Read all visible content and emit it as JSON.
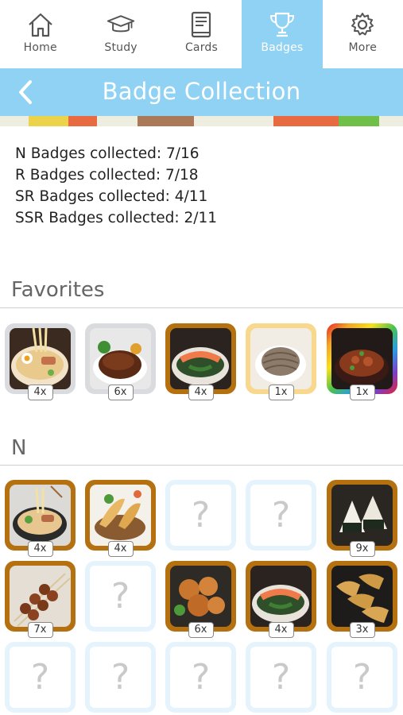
{
  "tabs": [
    {
      "label": "Home",
      "icon": "home-icon",
      "active": false
    },
    {
      "label": "Study",
      "icon": "graduation-cap-icon",
      "active": false
    },
    {
      "label": "Cards",
      "icon": "book-icon",
      "active": false
    },
    {
      "label": "Badges",
      "icon": "trophy-icon",
      "active": true
    },
    {
      "label": "More",
      "icon": "gear-icon",
      "active": false
    }
  ],
  "header": {
    "title": "Badge Collection",
    "back_icon": "chevron-left-icon"
  },
  "colors": {
    "accent": "#8fd2f3",
    "bronze": "#b5700f",
    "gray_frame": "#d9dbde",
    "gold_frame": "#f7d88c",
    "locked_border": "#e4f3fc"
  },
  "stats": [
    "N Badges collected: 7/16",
    "R Badges collected: 7/18",
    "SR Badges collected: 4/11",
    "SSR Badges collected: 2/11"
  ],
  "favorites": {
    "title": "Favorites",
    "items": [
      {
        "food": "ramen",
        "frame": "gray",
        "count": "4x"
      },
      {
        "food": "hamburg steak",
        "frame": "gray",
        "count": "6x"
      },
      {
        "food": "salmon bowl",
        "frame": "bronze",
        "count": "4x"
      },
      {
        "food": "soba",
        "frame": "gold",
        "count": "1x"
      },
      {
        "food": "beef bowl",
        "frame": "rainbow",
        "count": "1x"
      }
    ]
  },
  "n_section": {
    "title": "N",
    "locked_symbol": "?",
    "items": [
      {
        "food": "ramen",
        "frame": "bronze",
        "count": "4x",
        "unlocked": true
      },
      {
        "food": "tempura",
        "frame": "bronze",
        "count": "4x",
        "unlocked": true
      },
      {
        "unlocked": false
      },
      {
        "unlocked": false
      },
      {
        "food": "onigiri",
        "frame": "bronze",
        "count": "9x",
        "unlocked": true
      },
      {
        "food": "yakitori",
        "frame": "bronze",
        "count": "7x",
        "unlocked": true
      },
      {
        "unlocked": false
      },
      {
        "food": "karaage",
        "frame": "bronze",
        "count": "6x",
        "unlocked": true
      },
      {
        "food": "salmon bowl",
        "frame": "bronze",
        "count": "4x",
        "unlocked": true
      },
      {
        "food": "gyoza",
        "frame": "bronze",
        "count": "3x",
        "unlocked": true
      },
      {
        "unlocked": false
      },
      {
        "unlocked": false
      },
      {
        "unlocked": false
      },
      {
        "unlocked": false
      },
      {
        "unlocked": false
      }
    ]
  }
}
